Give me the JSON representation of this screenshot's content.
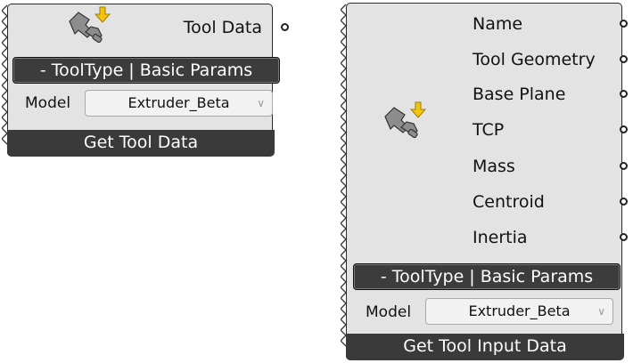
{
  "components": {
    "get_tool_data": {
      "outputs": [
        "Tool Data"
      ],
      "tooltype_button": "- ToolType | Basic Params",
      "model_label": "Model",
      "model_value": "Extruder_Beta",
      "footer_title": "Get Tool Data",
      "icon": "robot-tool-extruder-icon"
    },
    "get_tool_input_data": {
      "outputs": [
        "Name",
        "Tool Geometry",
        "Base Plane",
        "TCP",
        "Mass",
        "Centroid",
        "Inertia"
      ],
      "tooltype_button": "- ToolType | Basic Params",
      "model_label": "Model",
      "model_value": "Extruder_Beta",
      "footer_title": "Get Tool Input Data",
      "icon": "robot-tool-extruder-icon"
    }
  },
  "colors": {
    "component_body": "#e3e3e3",
    "footer": "#3a3a3a",
    "button": "#3c3c3c",
    "icon_arrow": "#f2c40e"
  }
}
